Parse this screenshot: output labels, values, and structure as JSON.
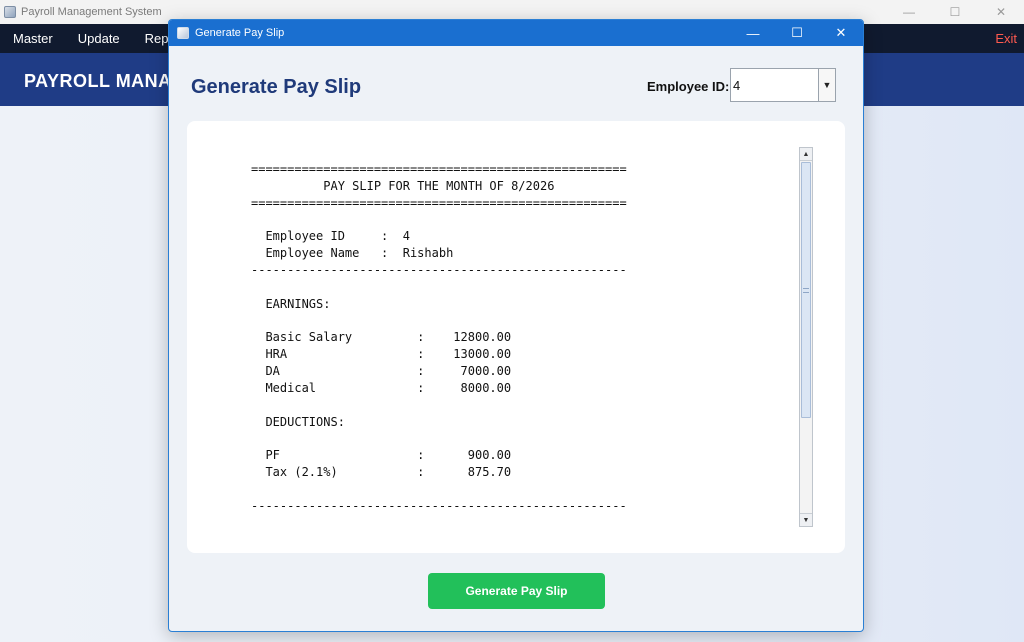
{
  "main_window": {
    "title": "Payroll Management System",
    "menu": [
      "Master",
      "Update",
      "Repo"
    ],
    "exit_label": "Exit",
    "banner_title": "PAYROLL MANAG",
    "window_controls": {
      "minimize": "—",
      "maximize": "☐",
      "close": "✕"
    }
  },
  "dialog": {
    "title": "Generate Pay Slip",
    "heading": "Generate Pay Slip",
    "employee_id_label": "Employee ID:",
    "employee_id_value": "4",
    "window_controls": {
      "minimize": "—",
      "maximize": "☐",
      "close": "✕"
    },
    "slip_text": "====================================================\n          PAY SLIP FOR THE MONTH OF 8/2026\n====================================================\n\n  Employee ID     :  4\n  Employee Name   :  Rishabh\n----------------------------------------------------\n\n  EARNINGS:\n\n  Basic Salary         :    12800.00\n  HRA                  :    13000.00\n  DA                   :     7000.00\n  Medical              :     8000.00\n\n  DEDUCTIONS:\n\n  PF                   :      900.00\n  Tax (2.1%)           :      875.70\n\n----------------------------------------------------",
    "button_label": "Generate Pay Slip"
  },
  "colors": {
    "menubar": "#101a2f",
    "banner": "#1f3c86",
    "dialog_titlebar": "#1a6fd0",
    "heading": "#1f3a7a",
    "button": "#22c05a",
    "exit": "#ff5a4f"
  }
}
